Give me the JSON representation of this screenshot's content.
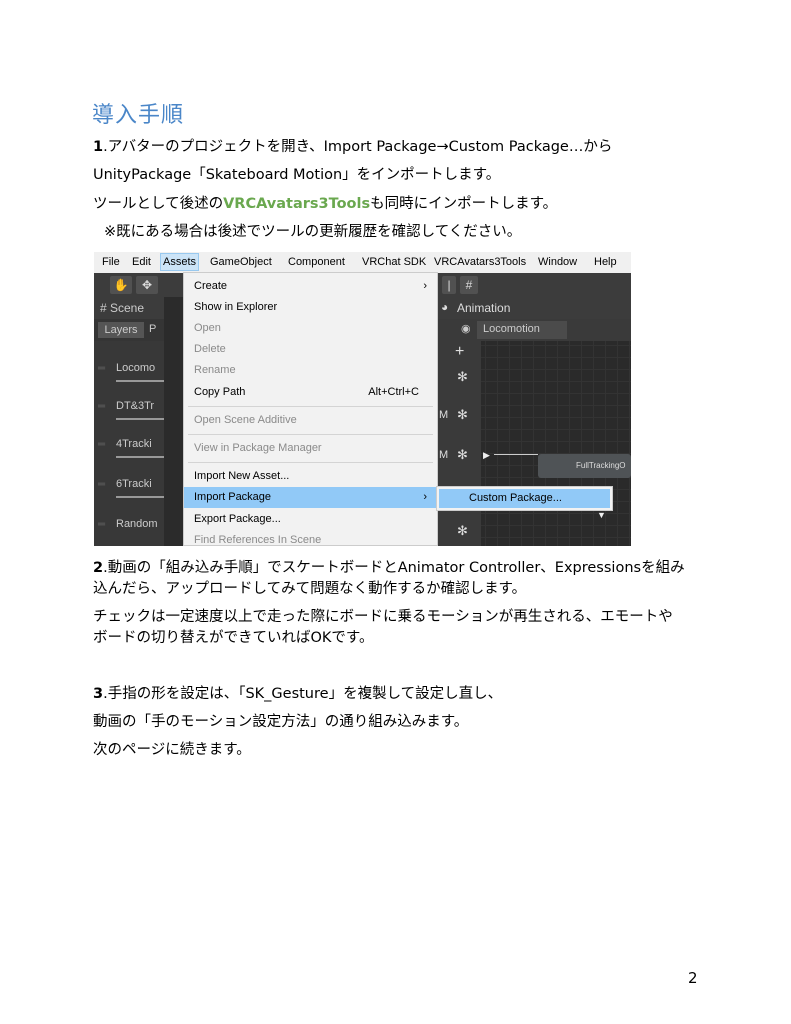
{
  "heading": "導入手順",
  "step1": {
    "num": "1",
    "line1": ".アバターのプロジェクトを開き、Import Package→Custom Package…から",
    "line2": "UnityPackage「Skateboard Motion」をインポートします。",
    "line3_pre": "ツールとして後述の",
    "line3_tool": "VRCAvatars3Tools",
    "line3_post": "も同時にインポートします。",
    "note": "※既にある場合は後述でツールの更新履歴を確認してください。"
  },
  "screenshot": {
    "menubar": [
      "File",
      "Edit",
      "Assets",
      "GameObject",
      "Component",
      "VRChat SDK",
      "VRCAvatars3Tools",
      "Window",
      "Help"
    ],
    "scene_tab": "# Scene",
    "layers_btn": "Layers",
    "layers_btn_extra": "P",
    "layers": [
      "Locomo",
      "DT&3Tr",
      "4Tracki",
      "6Tracki",
      "Random"
    ],
    "animation_tab": "Animation",
    "breadcrumb": "Locomotion",
    "node_label": "FullTrackingO",
    "menu_items": [
      {
        "label": "Create",
        "shortcut": "",
        "arrow": "›",
        "state": "normal"
      },
      {
        "label": "Show in Explorer",
        "shortcut": "",
        "arrow": "",
        "state": "normal"
      },
      {
        "label": "Open",
        "shortcut": "",
        "arrow": "",
        "state": "disabled"
      },
      {
        "label": "Delete",
        "shortcut": "",
        "arrow": "",
        "state": "disabled"
      },
      {
        "label": "Rename",
        "shortcut": "",
        "arrow": "",
        "state": "disabled"
      },
      {
        "label": "Copy Path",
        "shortcut": "Alt+Ctrl+C",
        "arrow": "",
        "state": "normal"
      },
      {
        "label": "Open Scene Additive",
        "shortcut": "",
        "arrow": "",
        "state": "disabled"
      },
      {
        "label": "View in Package Manager",
        "shortcut": "",
        "arrow": "",
        "state": "disabled"
      },
      {
        "label": "Import New Asset...",
        "shortcut": "",
        "arrow": "",
        "state": "normal"
      },
      {
        "label": "Import Package",
        "shortcut": "",
        "arrow": "›",
        "state": "highlighted"
      },
      {
        "label": "Export Package...",
        "shortcut": "",
        "arrow": "",
        "state": "normal"
      },
      {
        "label": "Find References In Scene",
        "shortcut": "",
        "arrow": "",
        "state": "disabled"
      }
    ],
    "submenu_item": "Custom Package..."
  },
  "step2": {
    "num": "2",
    "line1": ".動画の「組み込み手順」でスケートボードとAnimator Controller、Expressionsを組み",
    "line2": "込んだら、アップロードしてみて問題なく動作するか確認します。",
    "line3": "チェックは一定速度以上で走った際にボードに乗るモーションが再生される、エモートや",
    "line4": "ボードの切り替えができていればOKです。"
  },
  "step3": {
    "num": "3",
    "line1": ".手指の形を設定は、「SK_Gesture」を複製して設定し直し、",
    "line2": "動画の「手のモーション設定方法」の通り組み込みます。",
    "line3": "次のページに続きます。"
  },
  "page_number": "2",
  "colors": {
    "heading": "#4a86c8",
    "tool_link": "#6aa84f",
    "menu_highlight": "#91c9f7"
  }
}
